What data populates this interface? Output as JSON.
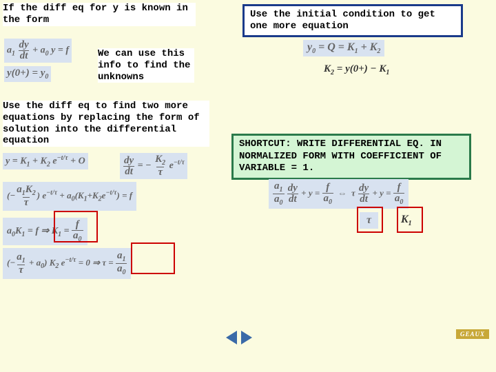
{
  "left": {
    "intro": "If the diff eq for y is known in the form",
    "eq1": "a₁ (dy/dt) + a₀ y = f",
    "eq2": "y(0+) = y₀",
    "hint": "We can use this info to find the unknowns",
    "step2": "Use the diff eq to find two more equations by replacing the form of solution into the differential equation",
    "eq3": "y = K₁ + K₂ e^{−t/τ} + O",
    "eq3r": "dy/dt = − (K₂/τ) e^{−t/τ}",
    "eq4": "(a₁ K₂/τ) e^{−t/τ} + a₀ K₁ + K₂ e^{−t/τ} = f",
    "eq5": "a₀ K₁ = f ⇒ K₁ = f / a₀",
    "eq6": "(a₁/τ + a₀) K₂ e^{−t/τ} = 0 ⇒ τ = a₁/a₀"
  },
  "right": {
    "ic": "Use the initial condition to get one more equation",
    "eq_ic1": "y₀ = Q = K₁ + K₂",
    "eq_ic2": "K₂ = y(0+) − K₁",
    "shortcut": "SHORTCUT: WRITE DIFFERENTIAL EQ. IN NORMALIZED FORM WITH COEFFICIENT OF VARIABLE = 1.",
    "eq_norm": "(a₁/a₀)(dy/dt) + y = f/a₀ ⇔ τ (dy/dt) + y = f/a₀",
    "tau_lbl": "τ",
    "k1_lbl": "K₁"
  },
  "logo": "GEAUX"
}
